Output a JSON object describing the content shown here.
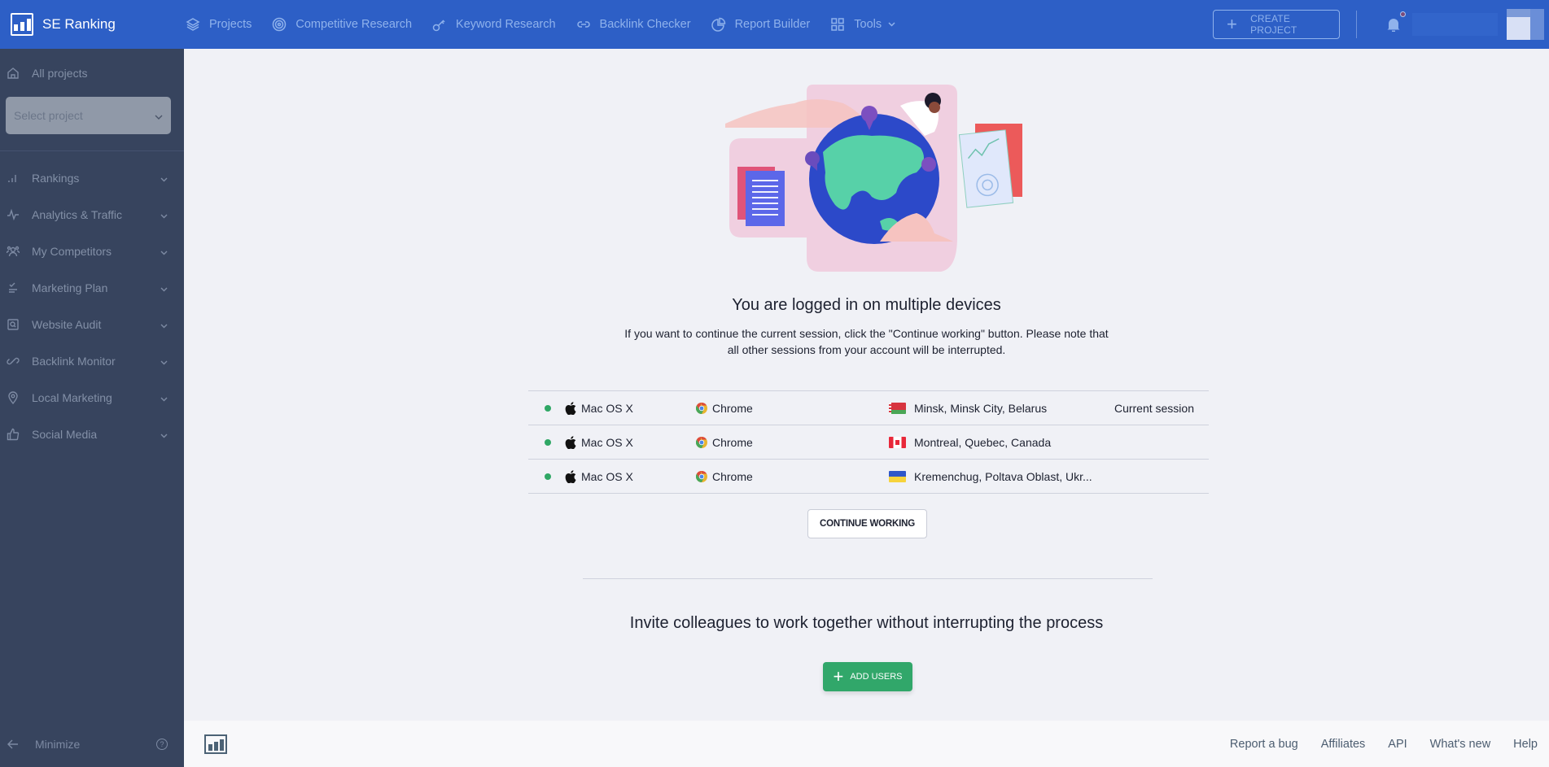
{
  "app": {
    "name": "SE Ranking"
  },
  "header": {
    "nav": [
      {
        "label": "Projects",
        "icon": "layers-icon"
      },
      {
        "label": "Competitive Research",
        "icon": "target-icon"
      },
      {
        "label": "Keyword Research",
        "icon": "key-icon"
      },
      {
        "label": "Backlink Checker",
        "icon": "link-icon"
      },
      {
        "label": "Report Builder",
        "icon": "pie-chart-icon"
      },
      {
        "label": "Tools",
        "icon": "grid-icon"
      }
    ],
    "create_project_label": "CREATE PROJECT"
  },
  "sidebar": {
    "all_projects_label": "All projects",
    "select_project_placeholder": "Select project",
    "items": [
      {
        "label": "Rankings"
      },
      {
        "label": "Analytics & Traffic"
      },
      {
        "label": "My Competitors"
      },
      {
        "label": "Marketing Plan"
      },
      {
        "label": "Website Audit"
      },
      {
        "label": "Backlink Monitor"
      },
      {
        "label": "Local Marketing"
      },
      {
        "label": "Social Media"
      }
    ],
    "minimize_label": "Minimize",
    "help_label": "?"
  },
  "main": {
    "title": "You are logged in on multiple devices",
    "description_line1": "If you want to continue the current session, click the \"Continue working\" button. Please note that",
    "description_line2": "all other sessions from your account will be interrupted.",
    "sessions": [
      {
        "os": "Mac OS X",
        "browser": "Chrome",
        "location": "Minsk, Minsk City, Belarus",
        "country": "belarus",
        "note": "Current session"
      },
      {
        "os": "Mac OS X",
        "browser": "Chrome",
        "location": "Montreal, Quebec, Canada",
        "country": "canada",
        "note": ""
      },
      {
        "os": "Mac OS X",
        "browser": "Chrome",
        "location": "Kremenchug, Poltava Oblast, Ukr...",
        "country": "ukraine",
        "note": ""
      }
    ],
    "continue_label": "CONTINUE WORKING",
    "invite_title": "Invite colleagues to work together without interrupting the process",
    "add_users_label": "ADD USERS"
  },
  "footer": {
    "links": [
      "Report a bug",
      "Affiliates",
      "API",
      "What's new",
      "Help"
    ]
  },
  "colors": {
    "header_bg": "#2d5fc6",
    "sidebar_bg": "#37445e",
    "main_bg": "#f0f1f6",
    "active_dot": "#2fa765",
    "add_button": "#31a76a"
  }
}
